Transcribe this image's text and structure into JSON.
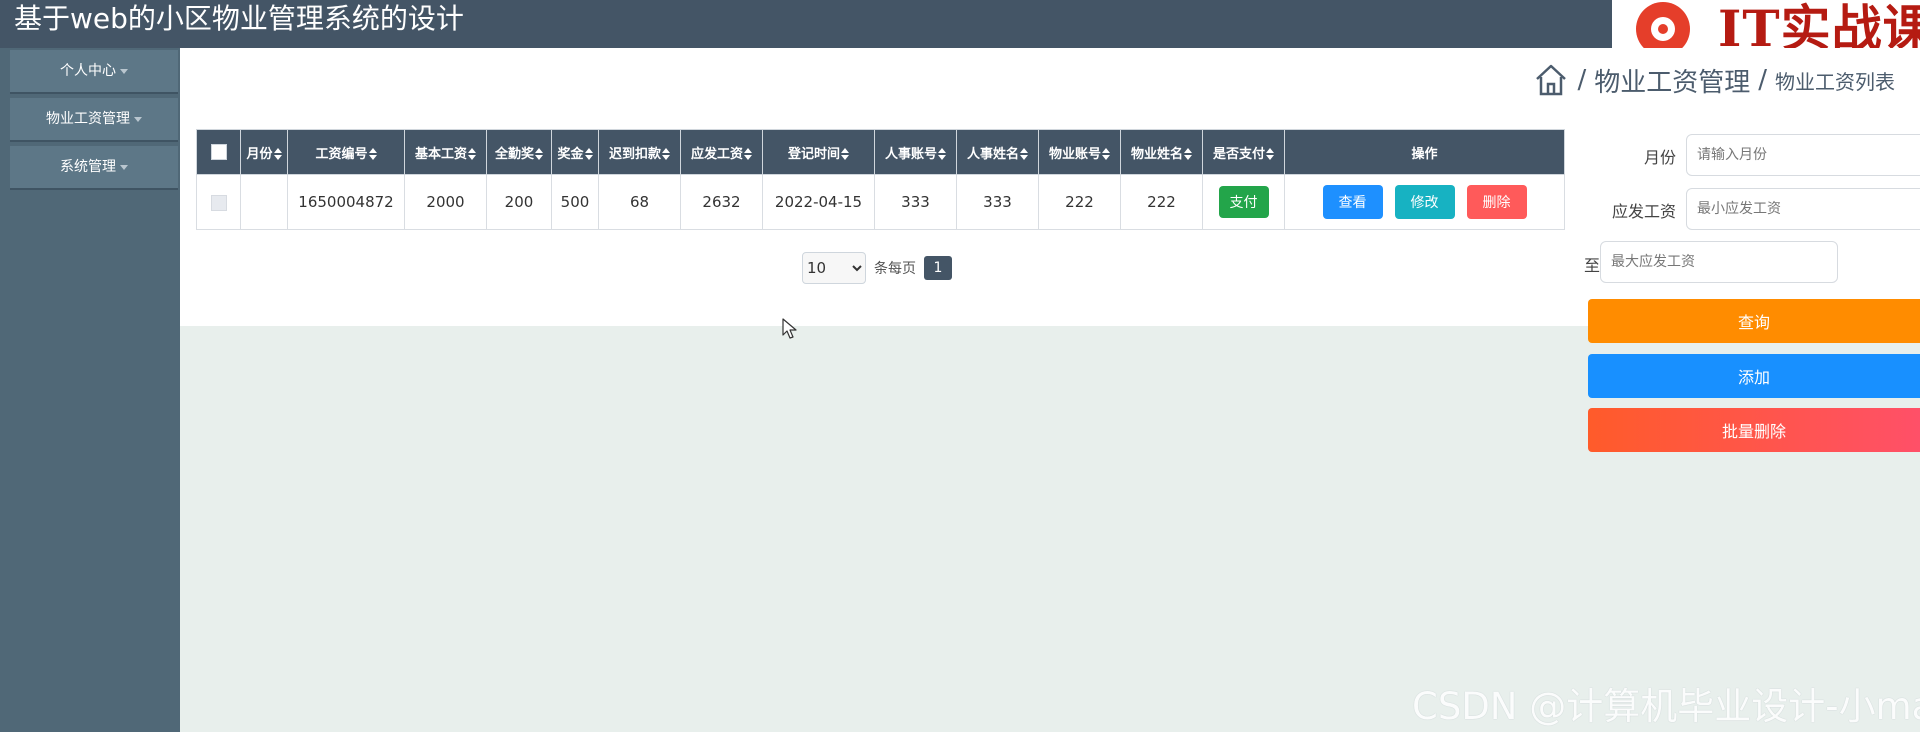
{
  "app": {
    "title": "基于web的小区物业管理系统的设计",
    "logo_text": "IT实战课"
  },
  "sidebar": {
    "items": [
      {
        "label": "个人中心"
      },
      {
        "label": "物业工资管理"
      },
      {
        "label": "系统管理"
      }
    ]
  },
  "breadcrumb": {
    "sep": "/",
    "level1": "物业工资管理",
    "level2": "物业工资列表"
  },
  "table": {
    "headers": [
      "月份",
      "工资编号",
      "基本工资",
      "全勤奖",
      "奖金",
      "迟到扣款",
      "应发工资",
      "登记时间",
      "人事账号",
      "人事姓名",
      "物业账号",
      "物业姓名",
      "是否支付",
      "操作"
    ],
    "rows": [
      {
        "month": "",
        "salary_no": "1650004872",
        "base": "2000",
        "attendance": "200",
        "bonus": "500",
        "late_deduct": "68",
        "payable": "2632",
        "reg_time": "2022-04-15",
        "hr_account": "333",
        "hr_name": "333",
        "prop_account": "222",
        "prop_name": "222",
        "pay_label": "支付",
        "view_label": "查看",
        "edit_label": "修改",
        "delete_label": "删除"
      }
    ]
  },
  "pager": {
    "page_size": "10",
    "per_page_text": "条每页",
    "current_page": "1"
  },
  "search": {
    "month_label": "月份",
    "month_placeholder": "请输入月份",
    "salary_label": "应发工资",
    "min_placeholder": "最小应发工资",
    "to_label": "至",
    "max_placeholder": "最大应发工资",
    "query_label": "查询",
    "add_label": "添加",
    "batch_delete_label": "批量删除"
  },
  "watermark": "CSDN @计算机毕业设计-小ma",
  "colors": {
    "header_bg": "#445566",
    "sidebar_bg": "#506877",
    "query": "#ff8c00",
    "add": "#1890ff",
    "batch_delete": "#ff5a5a",
    "pay": "#23a54a",
    "view": "#1e90ff",
    "edit": "#17b2c2",
    "delete": "#ff5a5a"
  }
}
